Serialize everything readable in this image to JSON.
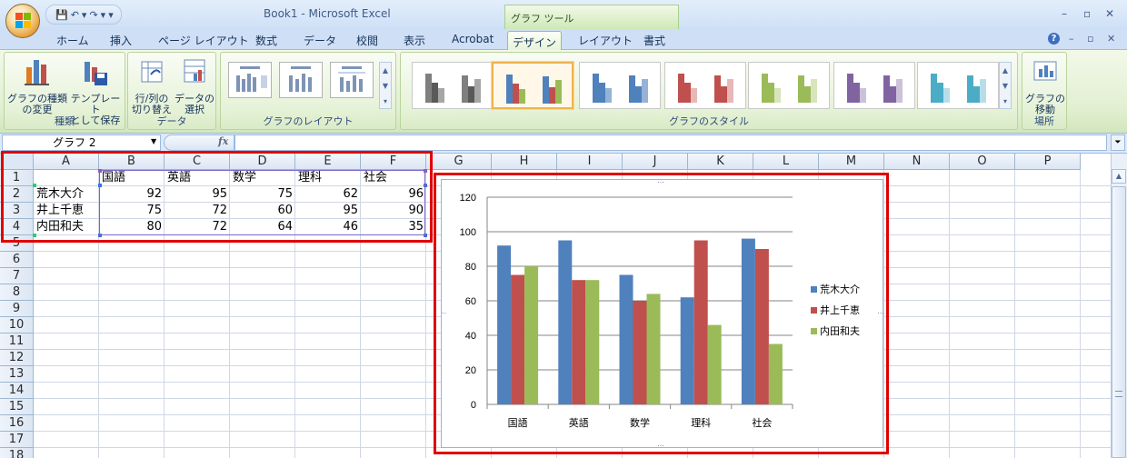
{
  "app": {
    "title": "Book1 - Microsoft Excel",
    "context_tab_group": "グラフ ツール"
  },
  "qat": {
    "save": "💾",
    "undo": "↶",
    "redo": "↷",
    "more": "▾"
  },
  "window_controls": {
    "minimize": "–",
    "restore": "▫",
    "close": "✕"
  },
  "ribbon_controls": {
    "help": "?",
    "minimize": "–",
    "restore": "▫",
    "close": "✕"
  },
  "tabs": [
    "ホーム",
    "挿入",
    "ページ レイアウト",
    "数式",
    "データ",
    "校閲",
    "表示",
    "Acrobat",
    "デザイン",
    "レイアウト",
    "書式"
  ],
  "active_tab": "デザイン",
  "ribbon": {
    "groups": {
      "type": {
        "label": "種類",
        "btn1": "グラフの種類\nの変更",
        "btn2": "テンプレート\nとして保存"
      },
      "data": {
        "label": "データ",
        "btn1": "行/列の\n切り替え",
        "btn2": "データの\n選択"
      },
      "layout": {
        "label": "グラフのレイアウト"
      },
      "style": {
        "label": "グラフのスタイル"
      },
      "location": {
        "label": "場所",
        "btn1": "グラフの\n移動"
      }
    },
    "style_colors": [
      [
        "#7f7f7f",
        "#595959",
        "#a6a6a6"
      ],
      [
        "#4f81bd",
        "#c0504d",
        "#9bbb59"
      ],
      [
        "#4f81bd",
        "#4f81bd",
        "#95b3d7"
      ],
      [
        "#c0504d",
        "#c0504d",
        "#e6b9b8"
      ],
      [
        "#9bbb59",
        "#9bbb59",
        "#d7e4bc"
      ],
      [
        "#8064a2",
        "#8064a2",
        "#ccc1da"
      ],
      [
        "#4bacc6",
        "#4bacc6",
        "#b7dee8"
      ]
    ]
  },
  "formula_bar": {
    "name_box": "グラフ 2",
    "fx": "fx",
    "formula": ""
  },
  "columns": [
    "A",
    "B",
    "C",
    "D",
    "E",
    "F",
    "G",
    "H",
    "I",
    "J",
    "K",
    "L",
    "M",
    "N",
    "O",
    "P"
  ],
  "rows": [
    "1",
    "2",
    "3",
    "4",
    "5",
    "6",
    "7",
    "8",
    "9",
    "10",
    "11",
    "12",
    "13",
    "14",
    "15",
    "16",
    "17",
    "18"
  ],
  "sheet": {
    "headers": [
      "国語",
      "英語",
      "数学",
      "理科",
      "社会"
    ],
    "data": [
      {
        "name": "荒木大介",
        "scores": [
          "92",
          "95",
          "75",
          "62",
          "96"
        ]
      },
      {
        "name": "井上千恵",
        "scores": [
          "75",
          "72",
          "60",
          "95",
          "90"
        ]
      },
      {
        "name": "内田和夫",
        "scores": [
          "80",
          "72",
          "64",
          "46",
          "35"
        ]
      }
    ]
  },
  "chart_data": {
    "type": "bar",
    "categories": [
      "国語",
      "英語",
      "数学",
      "理科",
      "社会"
    ],
    "series": [
      {
        "name": "荒木大介",
        "values": [
          92,
          95,
          75,
          62,
          96
        ],
        "color": "#4f81bd"
      },
      {
        "name": "井上千恵",
        "values": [
          75,
          72,
          60,
          95,
          90
        ],
        "color": "#c0504d"
      },
      {
        "name": "内田和夫",
        "values": [
          80,
          72,
          64,
          46,
          35
        ],
        "color": "#9bbb59"
      }
    ],
    "title": "",
    "xlabel": "",
    "ylabel": "",
    "ylim": [
      0,
      120
    ],
    "yticks": [
      "0",
      "20",
      "40",
      "60",
      "80",
      "100",
      "120"
    ],
    "grid": true,
    "legend": "right"
  }
}
